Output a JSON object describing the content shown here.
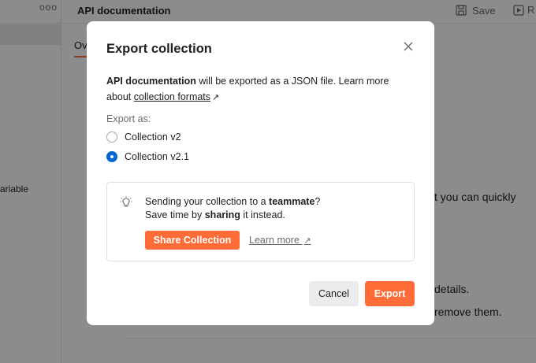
{
  "app": {
    "sidebar": {
      "more_label": "ooo",
      "variable_text": "ariable"
    },
    "header": {
      "title": "API documentation",
      "save_label": "Save",
      "run_label": "R"
    },
    "tab_label": "Ov",
    "content_lines": [
      "t you can quickly",
      "details.",
      "remove them."
    ]
  },
  "modal": {
    "title": "Export collection",
    "description": {
      "bold_name": "API documentation",
      "text_middle": " will be exported as a JSON file. Learn more about ",
      "link_label": "collection formats",
      "ext_arrow": "↗"
    },
    "export_as_label": "Export as:",
    "options": [
      {
        "label": "Collection v2",
        "checked": false
      },
      {
        "label": "Collection v2.1",
        "checked": true
      }
    ],
    "tip": {
      "line1_prefix": "Sending your collection to a ",
      "line1_bold": "teammate",
      "line1_suffix": "?",
      "line2_prefix": "Save time by ",
      "line2_bold": "sharing",
      "line2_suffix": " it instead.",
      "share_button": "Share Collection",
      "learn_more": "Learn more",
      "learn_more_arrow": "↗"
    },
    "buttons": {
      "cancel": "Cancel",
      "export": "Export"
    }
  },
  "colors": {
    "accent": "#ff6c37",
    "radio_selected": "#0265d2",
    "overlay": "rgba(0,0,0,0.45)"
  }
}
